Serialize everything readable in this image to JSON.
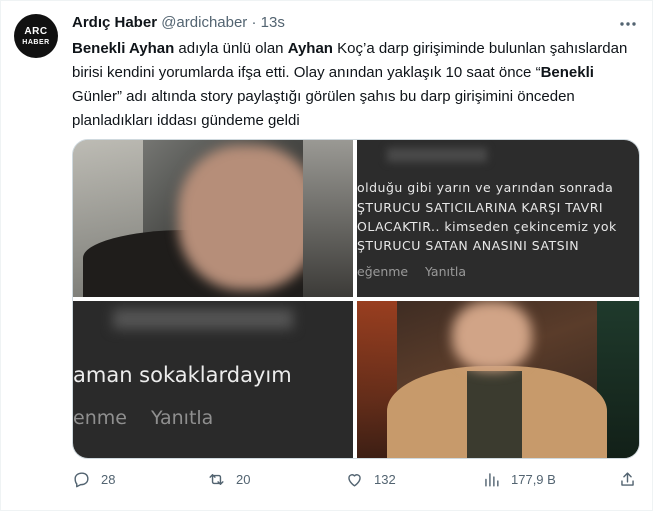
{
  "author": {
    "avatar_line1": "ARC",
    "avatar_line2": "HABER",
    "name": "Ardıç Haber",
    "handle": "@ardichaber",
    "separator": "·",
    "time": "13s"
  },
  "tweet": {
    "segments": [
      {
        "text": "Benekli Ayhan",
        "bold": true
      },
      {
        "text": " adıyla ünlü olan ",
        "bold": false
      },
      {
        "text": "Ayhan",
        "bold": true
      },
      {
        "text": " Koç’a darp girişiminde bulunlan şahıslardan birisi kendini yorumlarda ifşa etti. Olay anından yaklaşık 10 saat önce “",
        "bold": false
      },
      {
        "text": "Benekli",
        "bold": true
      },
      {
        "text": " Günler” adı altında story paylaştığı görülen şahıs bu darp girişimini önceden planladıkları iddası gündeme geldi",
        "bold": false
      }
    ]
  },
  "media": {
    "screenshot_top": {
      "lines": [
        "olduğu gibi yarın ve yarından sonrada",
        "ŞTURUCU SATICILARINA KARŞI TAVRI",
        "OLACAKTIR.. kimseden çekincemiz yok",
        "ŞTURUCU SATAN ANASINI SATSIN"
      ],
      "like": "eğenme",
      "reply": "Yanıtla"
    },
    "screenshot_bottom": {
      "line": "aman sokaklardayım",
      "like": "enme",
      "reply": "Yanıtla"
    }
  },
  "actions": {
    "replies": "28",
    "retweets": "20",
    "likes": "132",
    "views": "177,9 B"
  },
  "colors": {
    "text": "#0f1419",
    "secondary": "#536471",
    "border": "#cfd9de"
  },
  "icons": [
    "more-icon",
    "reply-icon",
    "retweet-icon",
    "like-icon",
    "views-icon",
    "share-icon"
  ]
}
